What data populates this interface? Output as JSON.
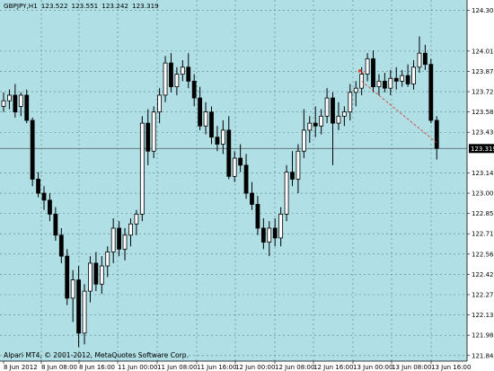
{
  "header": {
    "symbol": "GBPJPY,H1",
    "open": "123.522",
    "high": "123.551",
    "low": "123.242",
    "close": "123.319"
  },
  "footer": {
    "copyright": "Alpari MT4, © 2001-2012, MetaQuotes Software Corp."
  },
  "colors": {
    "background": "#b0dfe5",
    "grid": "#5a7f86",
    "bull_fill": "#ffffff",
    "bear_fill": "#000000",
    "outline": "#000000",
    "current_price_line": "#5a6b6e",
    "current_price_tag": "#000000",
    "trendline": "#e0302a"
  },
  "chart_data": {
    "type": "candlestick",
    "symbol": "GBPJPY",
    "timeframe": "H1",
    "ylim": [
      121.8,
      124.38
    ],
    "y_ticks": [
      "124.305",
      "124.015",
      "123.870",
      "123.725",
      "123.580",
      "123.435",
      "123.145",
      "123.000",
      "122.855",
      "122.710",
      "122.565",
      "122.420",
      "122.275",
      "122.130",
      "121.985",
      "121.840"
    ],
    "current_price": "123.319",
    "x_tick_labels": [
      "8 Jun 2012",
      "8 Jun 08:00",
      "8 Jun 16:00",
      "11 Jun 00:00",
      "11 Jun 08:00",
      "11 Jun 16:00",
      "12 Jun 00:00",
      "12 Jun 08:00",
      "12 Jun 16:00",
      "13 Jun 00:00",
      "13 Jun 08:00",
      "13 Jun 16:00"
    ],
    "candles": [
      {
        "o": 123.62,
        "h": 123.72,
        "l": 123.58,
        "c": 123.66
      },
      {
        "o": 123.66,
        "h": 123.74,
        "l": 123.6,
        "c": 123.7
      },
      {
        "o": 123.7,
        "h": 123.78,
        "l": 123.54,
        "c": 123.58
      },
      {
        "o": 123.62,
        "h": 123.72,
        "l": 123.55,
        "c": 123.7
      },
      {
        "o": 123.7,
        "h": 123.74,
        "l": 123.5,
        "c": 123.52
      },
      {
        "o": 123.52,
        "h": 123.54,
        "l": 123.05,
        "c": 123.1
      },
      {
        "o": 123.1,
        "h": 123.15,
        "l": 122.97,
        "c": 123.0
      },
      {
        "o": 123.0,
        "h": 123.05,
        "l": 122.88,
        "c": 122.95
      },
      {
        "o": 122.95,
        "h": 123.0,
        "l": 122.8,
        "c": 122.85
      },
      {
        "o": 122.85,
        "h": 122.9,
        "l": 122.66,
        "c": 122.7
      },
      {
        "o": 122.7,
        "h": 122.75,
        "l": 122.5,
        "c": 122.55
      },
      {
        "o": 122.55,
        "h": 122.6,
        "l": 122.2,
        "c": 122.25
      },
      {
        "o": 122.25,
        "h": 122.45,
        "l": 122.08,
        "c": 122.38
      },
      {
        "o": 122.38,
        "h": 122.48,
        "l": 121.9,
        "c": 122.0
      },
      {
        "o": 122.0,
        "h": 122.35,
        "l": 121.92,
        "c": 122.3
      },
      {
        "o": 122.3,
        "h": 122.55,
        "l": 122.22,
        "c": 122.5
      },
      {
        "o": 122.5,
        "h": 122.58,
        "l": 122.3,
        "c": 122.35
      },
      {
        "o": 122.35,
        "h": 122.55,
        "l": 122.28,
        "c": 122.48
      },
      {
        "o": 122.48,
        "h": 122.62,
        "l": 122.4,
        "c": 122.58
      },
      {
        "o": 122.58,
        "h": 122.82,
        "l": 122.5,
        "c": 122.75
      },
      {
        "o": 122.75,
        "h": 122.8,
        "l": 122.55,
        "c": 122.6
      },
      {
        "o": 122.6,
        "h": 122.75,
        "l": 122.52,
        "c": 122.7
      },
      {
        "o": 122.7,
        "h": 122.82,
        "l": 122.62,
        "c": 122.78
      },
      {
        "o": 122.78,
        "h": 122.88,
        "l": 122.7,
        "c": 122.85
      },
      {
        "o": 122.85,
        "h": 123.55,
        "l": 122.8,
        "c": 123.5
      },
      {
        "o": 123.5,
        "h": 123.6,
        "l": 123.2,
        "c": 123.3
      },
      {
        "o": 123.3,
        "h": 123.62,
        "l": 123.25,
        "c": 123.58
      },
      {
        "o": 123.58,
        "h": 123.75,
        "l": 123.5,
        "c": 123.7
      },
      {
        "o": 123.7,
        "h": 123.98,
        "l": 123.65,
        "c": 123.93
      },
      {
        "o": 123.93,
        "h": 124.0,
        "l": 123.72,
        "c": 123.76
      },
      {
        "o": 123.76,
        "h": 123.9,
        "l": 123.7,
        "c": 123.85
      },
      {
        "o": 123.85,
        "h": 123.95,
        "l": 123.8,
        "c": 123.9
      },
      {
        "o": 123.9,
        "h": 124.0,
        "l": 123.75,
        "c": 123.8
      },
      {
        "o": 123.8,
        "h": 123.85,
        "l": 123.62,
        "c": 123.68
      },
      {
        "o": 123.68,
        "h": 123.76,
        "l": 123.45,
        "c": 123.48
      },
      {
        "o": 123.48,
        "h": 123.65,
        "l": 123.42,
        "c": 123.58
      },
      {
        "o": 123.58,
        "h": 123.62,
        "l": 123.35,
        "c": 123.4
      },
      {
        "o": 123.4,
        "h": 123.48,
        "l": 123.3,
        "c": 123.35
      },
      {
        "o": 123.35,
        "h": 123.52,
        "l": 123.28,
        "c": 123.45
      },
      {
        "o": 123.45,
        "h": 123.55,
        "l": 123.1,
        "c": 123.12
      },
      {
        "o": 123.12,
        "h": 123.3,
        "l": 123.08,
        "c": 123.25
      },
      {
        "o": 123.25,
        "h": 123.35,
        "l": 123.15,
        "c": 123.2
      },
      {
        "o": 123.2,
        "h": 123.28,
        "l": 122.96,
        "c": 123.0
      },
      {
        "o": 123.0,
        "h": 123.08,
        "l": 122.88,
        "c": 122.92
      },
      {
        "o": 122.92,
        "h": 122.98,
        "l": 122.7,
        "c": 122.75
      },
      {
        "o": 122.75,
        "h": 122.82,
        "l": 122.6,
        "c": 122.65
      },
      {
        "o": 122.65,
        "h": 122.8,
        "l": 122.55,
        "c": 122.75
      },
      {
        "o": 122.75,
        "h": 122.82,
        "l": 122.62,
        "c": 122.68
      },
      {
        "o": 122.68,
        "h": 122.9,
        "l": 122.62,
        "c": 122.85
      },
      {
        "o": 122.85,
        "h": 123.2,
        "l": 122.8,
        "c": 123.15
      },
      {
        "o": 123.15,
        "h": 123.3,
        "l": 123.05,
        "c": 123.1
      },
      {
        "o": 123.1,
        "h": 123.35,
        "l": 123.0,
        "c": 123.3
      },
      {
        "o": 123.3,
        "h": 123.6,
        "l": 123.25,
        "c": 123.45
      },
      {
        "o": 123.45,
        "h": 123.55,
        "l": 123.36,
        "c": 123.5
      },
      {
        "o": 123.5,
        "h": 123.62,
        "l": 123.4,
        "c": 123.48
      },
      {
        "o": 123.48,
        "h": 123.6,
        "l": 123.42,
        "c": 123.55
      },
      {
        "o": 123.55,
        "h": 123.75,
        "l": 123.5,
        "c": 123.68
      },
      {
        "o": 123.68,
        "h": 123.72,
        "l": 123.2,
        "c": 123.5
      },
      {
        "o": 123.5,
        "h": 123.65,
        "l": 123.45,
        "c": 123.55
      },
      {
        "o": 123.55,
        "h": 123.62,
        "l": 123.48,
        "c": 123.58
      },
      {
        "o": 123.58,
        "h": 123.78,
        "l": 123.52,
        "c": 123.72
      },
      {
        "o": 123.72,
        "h": 123.8,
        "l": 123.62,
        "c": 123.75
      },
      {
        "o": 123.75,
        "h": 123.9,
        "l": 123.7,
        "c": 123.85
      },
      {
        "o": 123.85,
        "h": 124.0,
        "l": 123.8,
        "c": 123.96
      },
      {
        "o": 123.96,
        "h": 124.02,
        "l": 123.72,
        "c": 123.76
      },
      {
        "o": 123.76,
        "h": 123.85,
        "l": 123.7,
        "c": 123.8
      },
      {
        "o": 123.8,
        "h": 123.86,
        "l": 123.72,
        "c": 123.75
      },
      {
        "o": 123.75,
        "h": 123.88,
        "l": 123.7,
        "c": 123.82
      },
      {
        "o": 123.82,
        "h": 123.9,
        "l": 123.74,
        "c": 123.8
      },
      {
        "o": 123.8,
        "h": 123.88,
        "l": 123.76,
        "c": 123.84
      },
      {
        "o": 123.84,
        "h": 123.92,
        "l": 123.76,
        "c": 123.78
      },
      {
        "o": 123.78,
        "h": 123.95,
        "l": 123.74,
        "c": 123.9
      },
      {
        "o": 123.9,
        "h": 124.12,
        "l": 123.86,
        "c": 124.0
      },
      {
        "o": 124.0,
        "h": 124.06,
        "l": 123.88,
        "c": 123.92
      },
      {
        "o": 123.92,
        "h": 123.96,
        "l": 123.5,
        "c": 123.52
      },
      {
        "o": 123.52,
        "h": 123.55,
        "l": 123.24,
        "c": 123.32
      }
    ],
    "trendline": {
      "from": {
        "bar": 62,
        "price": 123.8
      },
      "to": {
        "bar": 75,
        "price": 123.36
      }
    },
    "arrow": {
      "bar": 62,
      "price": 123.88
    }
  }
}
